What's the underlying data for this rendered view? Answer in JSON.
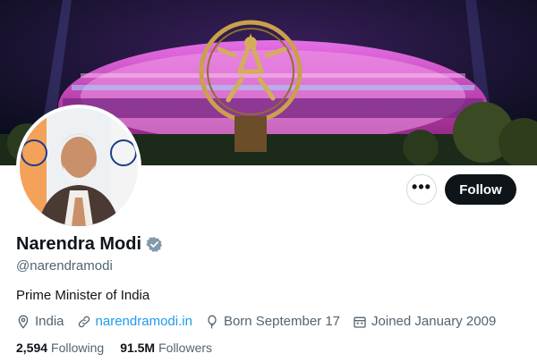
{
  "profile": {
    "name": "Narendra Modi",
    "handle": "@narendramodi",
    "bio": "Prime Minister of India",
    "location": "India",
    "website": "narendramodi.in",
    "born": "Born September 17",
    "joined": "Joined January 2009",
    "following_count": "2,594",
    "following_label": "Following",
    "followers_count": "91.5M",
    "followers_label": "Followers",
    "verified": true
  },
  "actions": {
    "more_label": "•••",
    "follow_label": "Follow"
  },
  "icons": {
    "more": "more-icon",
    "verified": "verified-badge-icon",
    "location": "location-pin-icon",
    "website": "link-icon",
    "born": "balloon-icon",
    "joined": "calendar-icon"
  },
  "colors": {
    "link": "#1d9bf0",
    "follow_bg": "#0f1419",
    "secondary_text": "#536471"
  }
}
